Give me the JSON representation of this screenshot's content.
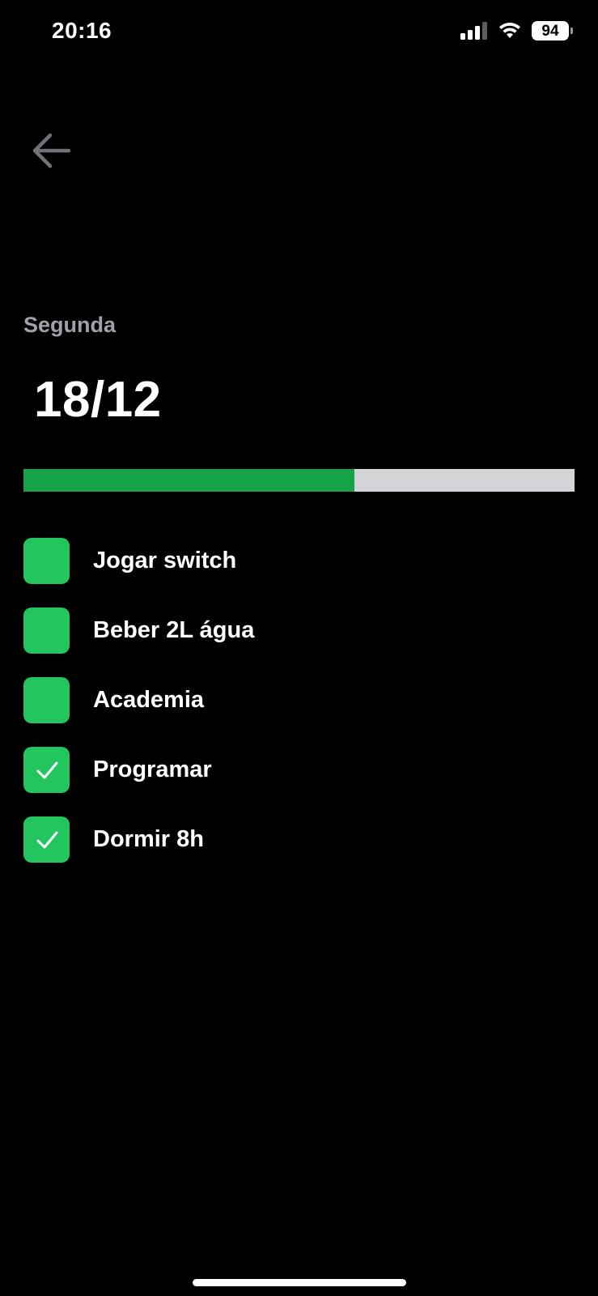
{
  "status_bar": {
    "time": "20:16",
    "battery_level": "94",
    "icons": [
      "signal-icon",
      "wifi-icon",
      "battery-icon"
    ]
  },
  "header": {
    "back_icon": "arrow-left-icon",
    "weekday": "Segunda",
    "date": "18/12"
  },
  "progress": {
    "completed_fraction": 0.6
  },
  "habits": [
    {
      "label": "Jogar switch",
      "checked": false
    },
    {
      "label": "Beber 2L água",
      "checked": false
    },
    {
      "label": "Academia",
      "checked": false
    },
    {
      "label": "Programar",
      "checked": true
    },
    {
      "label": "Dormir 8h",
      "checked": true
    }
  ],
  "colors": {
    "background": "#000000",
    "accent_green": "#22c55e",
    "progress_fill": "#16a34a",
    "progress_track": "#d4d4d8",
    "muted_text": "#a1a1aa"
  }
}
